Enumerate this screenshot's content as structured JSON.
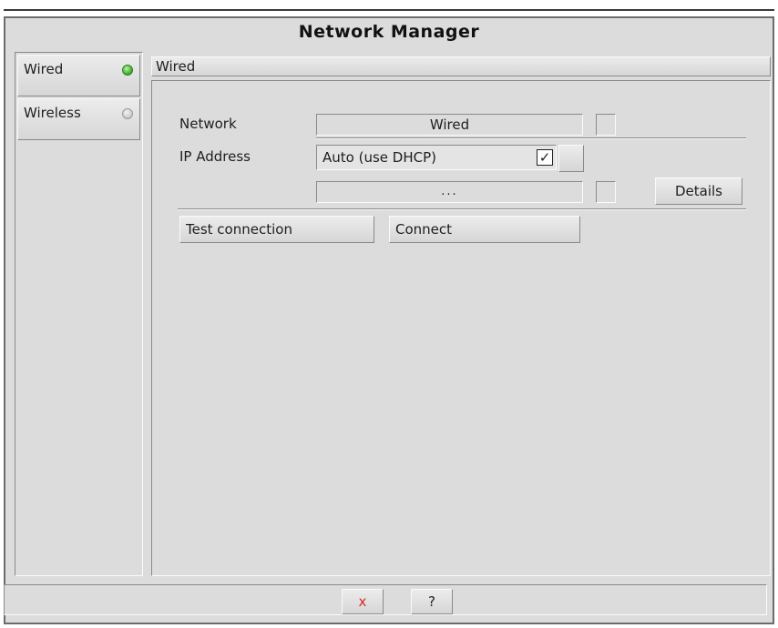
{
  "window": {
    "title": "Network Manager"
  },
  "sidebar": {
    "items": [
      {
        "label": "Wired",
        "status": "connected",
        "status_color": "#3aa52a"
      },
      {
        "label": "Wireless",
        "status": "disconnected",
        "status_color": "#c9c9c9"
      }
    ]
  },
  "panel": {
    "title": "Wired",
    "network_label": "Network",
    "network_value": "Wired",
    "ip_label": "IP Address",
    "ip_mode": "Auto (use DHCP)",
    "ip_auto_checked_glyph": "✓",
    "ip_value": "...",
    "details_label": "Details",
    "test_label": "Test connection",
    "connect_label": "Connect"
  },
  "footer": {
    "close_glyph": "x",
    "close_color": "#d62a2a",
    "help_glyph": "?"
  }
}
